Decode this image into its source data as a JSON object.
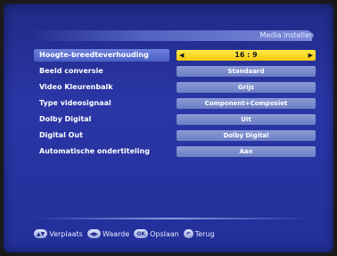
{
  "title": "Media instellen",
  "menu": [
    {
      "label": "Hoogte-breedteverhouding",
      "value": "16 : 9",
      "selected": true
    },
    {
      "label": "Beeld conversie",
      "value": "Standaard",
      "selected": false
    },
    {
      "label": "Video Kleurenbalk",
      "value": "Grijs",
      "selected": false
    },
    {
      "label": "Type videosignaal",
      "value": "Component+Composiet",
      "selected": false
    },
    {
      "label": "Dolby Digital",
      "value": "Uit",
      "selected": false
    },
    {
      "label": "Digital Out",
      "value": "Dolby Digital",
      "selected": false
    },
    {
      "label": "Automatische ondertiteling",
      "value": "Aan",
      "selected": false
    }
  ],
  "arrows": {
    "left": "◀",
    "right": "▶"
  },
  "footer": {
    "move": {
      "key": "▲▼",
      "label": "Verplaats"
    },
    "value": {
      "key": "◀▶",
      "label": "Waarde"
    },
    "save": {
      "key": "OK",
      "label": "Opslaan"
    },
    "back": {
      "key": "↶",
      "label": "Terug"
    }
  },
  "colors": {
    "background": "#2a36a6",
    "highlight": "#ffe94a",
    "option_box": "#7a8ccd"
  }
}
